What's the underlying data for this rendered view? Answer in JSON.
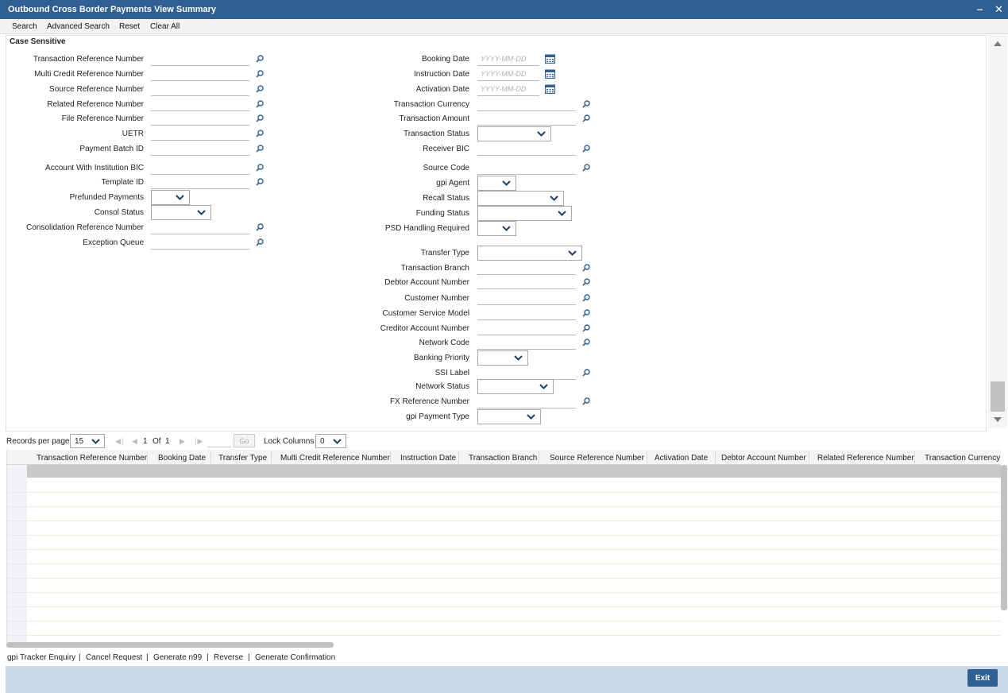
{
  "window": {
    "title": "Outbound Cross Border Payments View Summary",
    "minimize": "–",
    "close": "✕"
  },
  "menu": [
    "Search",
    "Advanced Search",
    "Reset",
    "Clear All"
  ],
  "criteria_legend": "Case Sensitive",
  "left_fields": [
    "Transaction Reference Number",
    "Multi Credit Reference Number",
    "Source Reference Number",
    "Related Reference Number",
    "File Reference Number",
    "UETR",
    "Payment Batch ID",
    "Account With Institution BIC",
    "Template ID",
    "Prefunded Payments",
    "Consol Status",
    "Consolidation Reference Number",
    "Exception Queue"
  ],
  "right_fields": [
    "Booking Date",
    "Instruction Date",
    "Activation Date",
    "Transaction Currency",
    "Transaction Amount",
    "Transaction Status",
    "Receiver BIC",
    "Source Code",
    "gpi Agent",
    "Recall Status",
    "Funding Status",
    "PSD Handling Required",
    "Transfer Type",
    "Transaction Branch",
    "Debtor Account Number",
    "Customer Number",
    "Customer Service Model",
    "Creditor Account Number",
    "Network Code",
    "Banking Priority",
    "SSI Label",
    "Network Status",
    "FX Reference Number",
    "gpi Payment Type"
  ],
  "date_placeholder": "YYYY-MM-DD",
  "pager": {
    "records_label": "Records per page",
    "records_value": "15",
    "page_current": "1",
    "page_of": "Of",
    "page_total": "1",
    "go_label": "Go",
    "lock_label": "Lock Columns",
    "lock_value": "0"
  },
  "columns": [
    "Transaction Reference Number",
    "Booking Date",
    "Transfer Type",
    "Multi Credit Reference Number",
    "Instruction Date",
    "Transaction Branch",
    "Source Reference Number",
    "Activation Date",
    "Debtor Account Number",
    "Related Reference Number",
    "Transaction Currency"
  ],
  "actions": [
    "gpi Tracker Enquiry",
    "Cancel Request",
    "Generate n99",
    "Reverse",
    "Generate Confirmation"
  ],
  "action_separator": "|",
  "exit_label": "Exit",
  "icons": {
    "lookup": "magnifier-icon",
    "calendar": "calendar-icon",
    "dropdown": "chevron-down-icon"
  },
  "colors": {
    "titlebar": "#2f5f93",
    "footer": "#c8d9ea",
    "accent": "#2f5f93"
  }
}
